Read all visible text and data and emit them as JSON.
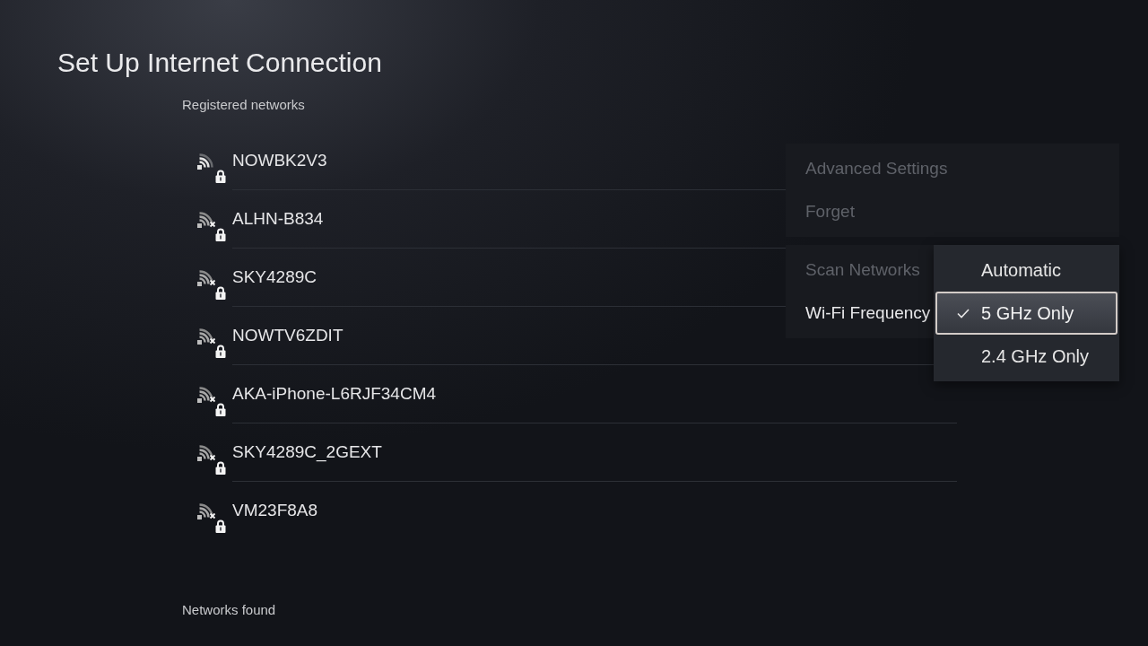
{
  "title": "Set Up Internet Connection",
  "registered_networks": {
    "label": "Registered networks",
    "networks": [
      {
        "name": "NOWBK2V3",
        "connected": true,
        "secured": true
      },
      {
        "name": "ALHN-B834",
        "connected": false,
        "secured": true
      },
      {
        "name": "SKY4289C",
        "connected": false,
        "secured": true
      },
      {
        "name": "NOWTV6ZDIT",
        "connected": false,
        "secured": true
      },
      {
        "name": "AKA-iPhone-L6RJF34CM4",
        "connected": false,
        "secured": true
      },
      {
        "name": "SKY4289C_2GEXT",
        "connected": false,
        "secured": true
      },
      {
        "name": "VM23F8A8",
        "connected": false,
        "secured": true
      }
    ]
  },
  "networks_found": {
    "label": "Networks found"
  },
  "context_menu": {
    "groups": [
      {
        "items": [
          {
            "label": "Advanced Settings",
            "expanded": false
          },
          {
            "label": "Forget",
            "expanded": false
          }
        ]
      },
      {
        "items": [
          {
            "label": "Scan Networks",
            "expanded": false
          },
          {
            "label": "Wi-Fi Frequency",
            "expanded": true,
            "options": [
              {
                "label": "Automatic",
                "selected": false
              },
              {
                "label": "5 GHz Only",
                "selected": true
              },
              {
                "label": "2.4 GHz Only",
                "selected": false
              }
            ]
          }
        ]
      }
    ]
  }
}
